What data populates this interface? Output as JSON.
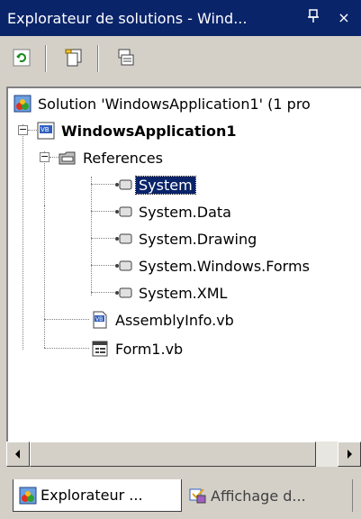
{
  "window": {
    "title": "Explorateur de solutions - Wind...",
    "pin_glyph": "Ա",
    "close_glyph": "×"
  },
  "toolbar": {
    "buttons": [
      {
        "icon": "refresh-icon"
      },
      {
        "icon": "show-all-files-icon"
      },
      {
        "icon": "properties-icon"
      }
    ]
  },
  "tree": {
    "solution": "Solution 'WindowsApplication1' (1 pro",
    "project": "WindowsApplication1",
    "references": "References",
    "refs": [
      "System",
      "System.Data",
      "System.Drawing",
      "System.Windows.Forms",
      "System.XML"
    ],
    "files": [
      "AssemblyInfo.vb",
      "Form1.vb"
    ],
    "selected": "System"
  },
  "tabs": [
    {
      "label": "Explorateur ...",
      "icon": "solution-explorer-icon"
    },
    {
      "label": "Affichage d...",
      "icon": "class-view-icon"
    }
  ],
  "colors": {
    "title_bg": "#0a246a",
    "panel_bg": "#d4d0c8",
    "selection_bg": "#0a246a"
  }
}
